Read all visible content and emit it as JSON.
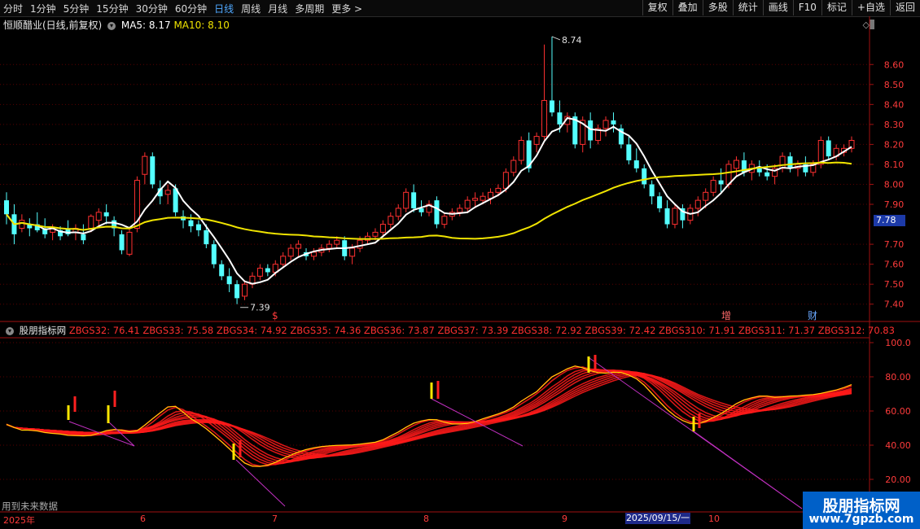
{
  "toolbar": {
    "periods": [
      "分时",
      "1分钟",
      "5分钟",
      "15分钟",
      "30分钟",
      "60分钟",
      "日线",
      "周线",
      "月线",
      "多周期",
      "更多 >"
    ],
    "active": "日线",
    "right": [
      "复权",
      "叠加",
      "多股",
      "统计",
      "画线",
      "F10",
      "标记",
      "+自选",
      "返回"
    ]
  },
  "main_panel": {
    "stock_name": "恒顺醋业(日线,前复权)",
    "ma5": "MA5: 8.17",
    "ma10": "MA10: 8.10",
    "y_ticks": [
      "8.60",
      "8.50",
      "8.40",
      "8.30",
      "8.20",
      "8.10",
      "8.00",
      "7.90",
      "7.70",
      "7.60",
      "7.50",
      "7.40"
    ],
    "current_price": "7.78",
    "high_label": "8.74",
    "low_label": "7.39",
    "markers": [
      "$",
      "增",
      "财"
    ]
  },
  "indicator_panel": {
    "name": "股朋指标网",
    "values": [
      "ZBGS32: 76.41",
      "ZBGS33: 75.58",
      "ZBGS34: 74.92",
      "ZBGS35: 74.36",
      "ZBGS36: 73.87",
      "ZBGS37: 73.39",
      "ZBGS38: 72.92",
      "ZBGS39: 72.42",
      "ZBGS310: 71.91",
      "ZBGS311: 71.37",
      "ZBGS312: 70.83"
    ],
    "y_ticks": [
      "100.0",
      "80.00",
      "60.00",
      "40.00",
      "20.00"
    ],
    "future_note": "用到未来数据"
  },
  "date_axis": {
    "labels": [
      "2025年",
      "6",
      "7",
      "8",
      "9",
      "10"
    ],
    "cursor_date": "2025/09/15/一"
  },
  "watermark": {
    "title": "股朋指标网",
    "url": "www.7gpzb.com"
  },
  "chart_data": {
    "type": "candlestick",
    "y_range": [
      7.35,
      8.76
    ],
    "ma5_color": "#ffffff",
    "ma10_color": "#f0e400",
    "up_color": "#ff3030",
    "down_color": "#54ffff",
    "ohlc": [
      [
        7.92,
        7.96,
        7.8,
        7.85
      ],
      [
        7.85,
        7.9,
        7.7,
        7.75
      ],
      [
        7.78,
        7.85,
        7.76,
        7.82
      ],
      [
        7.8,
        7.83,
        7.74,
        7.78
      ],
      [
        7.8,
        7.86,
        7.76,
        7.77
      ],
      [
        7.78,
        7.83,
        7.73,
        7.75
      ],
      [
        7.76,
        7.8,
        7.72,
        7.78
      ],
      [
        7.77,
        7.79,
        7.72,
        7.74
      ],
      [
        7.78,
        7.82,
        7.74,
        7.75
      ],
      [
        7.76,
        7.8,
        7.72,
        7.78
      ],
      [
        7.75,
        7.8,
        7.7,
        7.72
      ],
      [
        7.78,
        7.85,
        7.76,
        7.84
      ],
      [
        7.82,
        7.88,
        7.78,
        7.86
      ],
      [
        7.86,
        7.9,
        7.8,
        7.84
      ],
      [
        7.82,
        7.84,
        7.74,
        7.78
      ],
      [
        7.75,
        7.77,
        7.65,
        7.67
      ],
      [
        7.65,
        7.78,
        7.64,
        7.76
      ],
      [
        7.78,
        8.04,
        7.76,
        8.02
      ],
      [
        8.05,
        8.16,
        8.0,
        8.14
      ],
      [
        8.14,
        8.16,
        7.98,
        8.0
      ],
      [
        7.98,
        8.02,
        7.9,
        7.94
      ],
      [
        7.95,
        8.0,
        7.9,
        7.97
      ],
      [
        7.98,
        8.0,
        7.84,
        7.86
      ],
      [
        7.84,
        7.87,
        7.78,
        7.82
      ],
      [
        7.82,
        7.85,
        7.76,
        7.79
      ],
      [
        7.8,
        7.82,
        7.74,
        7.77
      ],
      [
        7.77,
        7.8,
        7.68,
        7.7
      ],
      [
        7.7,
        7.72,
        7.58,
        7.6
      ],
      [
        7.6,
        7.62,
        7.52,
        7.54
      ],
      [
        7.54,
        7.58,
        7.46,
        7.5
      ],
      [
        7.5,
        7.52,
        7.4,
        7.43
      ],
      [
        7.44,
        7.52,
        7.42,
        7.5
      ],
      [
        7.5,
        7.56,
        7.48,
        7.54
      ],
      [
        7.54,
        7.6,
        7.52,
        7.58
      ],
      [
        7.58,
        7.6,
        7.54,
        7.56
      ],
      [
        7.56,
        7.62,
        7.54,
        7.6
      ],
      [
        7.6,
        7.66,
        7.58,
        7.64
      ],
      [
        7.64,
        7.7,
        7.62,
        7.68
      ],
      [
        7.68,
        7.72,
        7.64,
        7.7
      ],
      [
        7.66,
        7.68,
        7.62,
        7.64
      ],
      [
        7.64,
        7.68,
        7.62,
        7.66
      ],
      [
        7.66,
        7.7,
        7.64,
        7.68
      ],
      [
        7.68,
        7.72,
        7.66,
        7.7
      ],
      [
        7.7,
        7.74,
        7.68,
        7.72
      ],
      [
        7.72,
        7.74,
        7.62,
        7.64
      ],
      [
        7.64,
        7.7,
        7.6,
        7.68
      ],
      [
        7.68,
        7.74,
        7.66,
        7.72
      ],
      [
        7.72,
        7.76,
        7.7,
        7.74
      ],
      [
        7.74,
        7.78,
        7.72,
        7.76
      ],
      [
        7.76,
        7.82,
        7.74,
        7.8
      ],
      [
        7.8,
        7.86,
        7.78,
        7.84
      ],
      [
        7.84,
        7.9,
        7.82,
        7.88
      ],
      [
        7.88,
        7.98,
        7.86,
        7.96
      ],
      [
        7.96,
        8.0,
        7.86,
        7.88
      ],
      [
        7.88,
        7.92,
        7.84,
        7.86
      ],
      [
        7.86,
        7.92,
        7.84,
        7.9
      ],
      [
        7.92,
        7.94,
        7.78,
        7.8
      ],
      [
        7.8,
        7.86,
        7.78,
        7.84
      ],
      [
        7.84,
        7.88,
        7.82,
        7.86
      ],
      [
        7.86,
        7.9,
        7.84,
        7.88
      ],
      [
        7.88,
        7.94,
        7.86,
        7.92
      ],
      [
        7.92,
        7.96,
        7.88,
        7.93
      ],
      [
        7.92,
        7.96,
        7.9,
        7.94
      ],
      [
        7.93,
        7.98,
        7.9,
        7.96
      ],
      [
        7.96,
        8.0,
        7.94,
        7.98
      ],
      [
        7.98,
        8.08,
        7.96,
        8.06
      ],
      [
        8.06,
        8.14,
        8.04,
        8.12
      ],
      [
        8.12,
        8.24,
        8.1,
        8.22
      ],
      [
        8.22,
        8.26,
        8.06,
        8.08
      ],
      [
        8.2,
        8.26,
        8.16,
        8.24
      ],
      [
        8.24,
        8.7,
        8.22,
        8.42
      ],
      [
        8.42,
        8.74,
        8.34,
        8.36
      ],
      [
        8.36,
        8.42,
        8.26,
        8.3
      ],
      [
        8.3,
        8.36,
        8.26,
        8.34
      ],
      [
        8.34,
        8.36,
        8.18,
        8.2
      ],
      [
        8.2,
        8.34,
        8.16,
        8.32
      ],
      [
        8.32,
        8.36,
        8.18,
        8.22
      ],
      [
        8.22,
        8.3,
        8.2,
        8.28
      ],
      [
        8.28,
        8.34,
        8.24,
        8.32
      ],
      [
        8.32,
        8.36,
        8.26,
        8.3
      ],
      [
        8.28,
        8.3,
        8.18,
        8.2
      ],
      [
        8.2,
        8.24,
        8.1,
        8.12
      ],
      [
        8.12,
        8.18,
        8.06,
        8.08
      ],
      [
        8.08,
        8.1,
        7.98,
        8.0
      ],
      [
        8.0,
        8.02,
        7.9,
        7.94
      ],
      [
        7.94,
        7.96,
        7.86,
        7.88
      ],
      [
        7.88,
        7.92,
        7.78,
        7.8
      ],
      [
        7.8,
        7.9,
        7.78,
        7.88
      ],
      [
        7.88,
        7.9,
        7.78,
        7.82
      ],
      [
        7.82,
        7.9,
        7.8,
        7.88
      ],
      [
        7.88,
        7.94,
        7.84,
        7.92
      ],
      [
        7.92,
        7.98,
        7.88,
        7.96
      ],
      [
        7.96,
        8.04,
        7.94,
        8.02
      ],
      [
        8.02,
        8.08,
        7.96,
        8.0
      ],
      [
        8.0,
        8.12,
        7.98,
        8.1
      ],
      [
        8.08,
        8.14,
        8.04,
        8.12
      ],
      [
        8.12,
        8.16,
        8.04,
        8.06
      ],
      [
        8.06,
        8.12,
        8.02,
        8.1
      ],
      [
        8.08,
        8.12,
        8.04,
        8.06
      ],
      [
        8.06,
        8.1,
        8.02,
        8.04
      ],
      [
        8.04,
        8.1,
        8.0,
        8.08
      ],
      [
        8.08,
        8.16,
        8.06,
        8.14
      ],
      [
        8.14,
        8.16,
        8.06,
        8.08
      ],
      [
        8.08,
        8.12,
        8.04,
        8.1
      ],
      [
        8.1,
        8.14,
        8.04,
        8.06
      ],
      [
        8.06,
        8.12,
        8.04,
        8.1
      ],
      [
        8.1,
        8.24,
        8.08,
        8.22
      ],
      [
        8.22,
        8.24,
        8.12,
        8.14
      ],
      [
        8.14,
        8.2,
        8.12,
        8.18
      ],
      [
        8.16,
        8.2,
        8.14,
        8.18
      ],
      [
        8.18,
        8.24,
        8.16,
        8.22
      ]
    ]
  }
}
